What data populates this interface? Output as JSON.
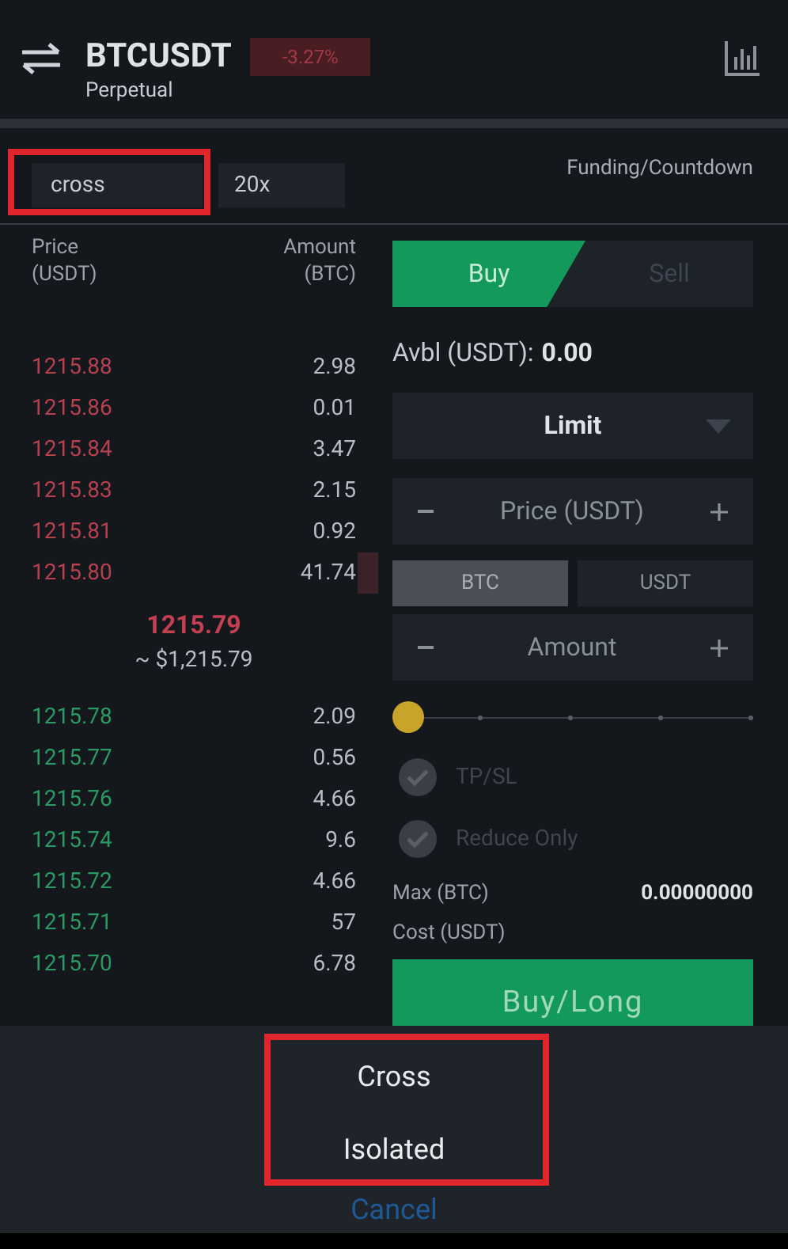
{
  "header": {
    "symbol": "BTCUSDT",
    "subtitle": "Perpetual",
    "change": "-3.27%"
  },
  "controls": {
    "margin_mode": "cross",
    "leverage": "20x",
    "funding": "Funding/Countdown"
  },
  "order_book": {
    "price_header": "Price\n(USDT)",
    "amount_header": "Amount\n(BTC)",
    "asks": [
      {
        "price": "1215.88",
        "amount": "2.98"
      },
      {
        "price": "1215.86",
        "amount": "0.01"
      },
      {
        "price": "1215.84",
        "amount": "3.47"
      },
      {
        "price": "1215.83",
        "amount": "2.15"
      },
      {
        "price": "1215.81",
        "amount": "0.92"
      },
      {
        "price": "1215.80",
        "amount": "41.74",
        "depth_bar": true
      }
    ],
    "last_price": "1215.79",
    "last_price_usd": "~ $1,215.79",
    "bids": [
      {
        "price": "1215.78",
        "amount": "2.09"
      },
      {
        "price": "1215.77",
        "amount": "0.56"
      },
      {
        "price": "1215.76",
        "amount": "4.66"
      },
      {
        "price": "1215.74",
        "amount": "9.6"
      },
      {
        "price": "1215.72",
        "amount": "4.66"
      },
      {
        "price": "1215.71",
        "amount": "57"
      },
      {
        "price": "1215.70",
        "amount": "6.78"
      }
    ]
  },
  "order_form": {
    "tabs": [
      {
        "label": "Buy",
        "selected": true
      },
      {
        "label": "Sell",
        "selected": false
      }
    ],
    "available_label": "Avbl (USDT):",
    "available_value": "0.00",
    "order_type": "Limit",
    "price_placeholder": "Price (USDT)",
    "units": [
      {
        "label": "BTC",
        "selected": true
      },
      {
        "label": "USDT",
        "selected": false
      }
    ],
    "amount_placeholder": "Amount",
    "slider": {
      "level": 0
    },
    "options": [
      {
        "label": "TP/SL",
        "checked": false
      },
      {
        "label": "Reduce Only",
        "checked": false
      }
    ],
    "max_label": "Max (BTC)",
    "max_value": "0.00000000",
    "cost_label": "Cost (USDT)",
    "submit": "Buy/Long"
  },
  "sheet": {
    "options": [
      {
        "label": "Cross"
      },
      {
        "label": "Isolated"
      }
    ],
    "cancel": "Cancel"
  }
}
